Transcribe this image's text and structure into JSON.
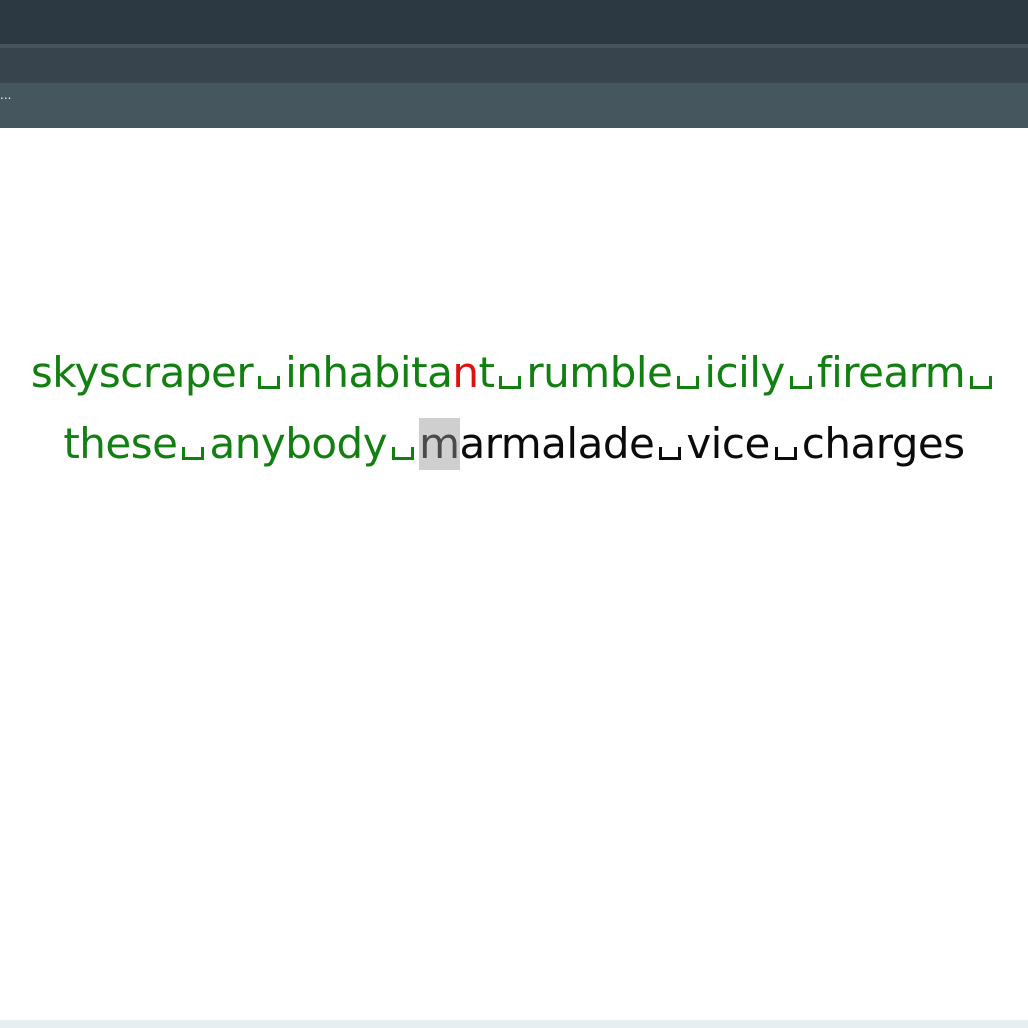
{
  "window": {
    "status_text": "..."
  },
  "typing": {
    "lines": [
      {
        "segments": [
          {
            "text": "skyscraper",
            "state": "typed"
          },
          {
            "text": "space",
            "state": "typed"
          },
          {
            "text": "inhabita",
            "state": "typed"
          },
          {
            "text": "n",
            "state": "error"
          },
          {
            "text": "t",
            "state": "typed"
          },
          {
            "text": "space",
            "state": "typed"
          },
          {
            "text": "rumble",
            "state": "typed"
          },
          {
            "text": "space",
            "state": "typed"
          },
          {
            "text": "icily",
            "state": "typed"
          },
          {
            "text": "space",
            "state": "typed"
          },
          {
            "text": "firearm",
            "state": "typed"
          },
          {
            "text": "space",
            "state": "typed"
          }
        ]
      },
      {
        "segments": [
          {
            "text": "these",
            "state": "typed"
          },
          {
            "text": "space",
            "state": "typed"
          },
          {
            "text": "anybody",
            "state": "typed"
          },
          {
            "text": "space",
            "state": "typed"
          },
          {
            "text": "m",
            "state": "cursor"
          },
          {
            "text": "armalade",
            "state": "pending"
          },
          {
            "text": "space",
            "state": "pending"
          },
          {
            "text": "vice",
            "state": "pending"
          },
          {
            "text": "space",
            "state": "pending"
          },
          {
            "text": "charges",
            "state": "pending"
          }
        ]
      }
    ]
  },
  "colors": {
    "typed": "#118011",
    "error": "#e11010",
    "pending": "#0b0b0b",
    "cursor_bg": "#cfcfcf",
    "titlebar": "#2c3842",
    "toolbar": "#37444e",
    "statusbar": "#45565f"
  }
}
